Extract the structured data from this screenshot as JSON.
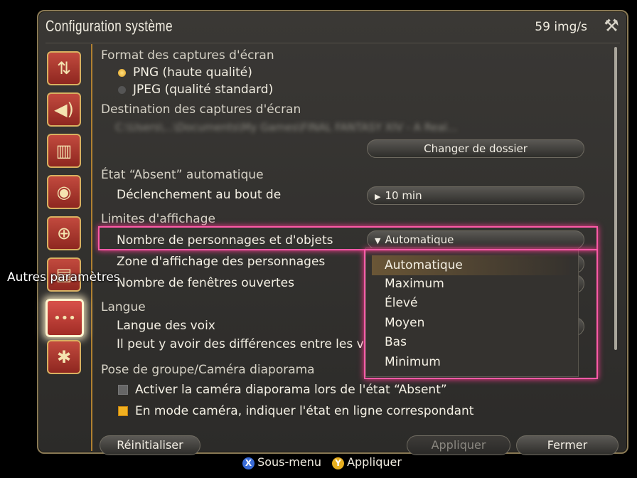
{
  "window": {
    "title": "Configuration système",
    "fps": "59 img/s",
    "tool_icon": "tools-icon"
  },
  "sidebar": {
    "tooltip": "Autres paramètres",
    "items": [
      {
        "icon": "display-icon",
        "glyph": "⇅"
      },
      {
        "icon": "sound-icon",
        "glyph": "🔊"
      },
      {
        "icon": "theater-icon",
        "glyph": "▥"
      },
      {
        "icon": "mouse-icon",
        "glyph": "🖱"
      },
      {
        "icon": "gamepad-icon",
        "glyph": "🎮"
      },
      {
        "icon": "document-icon",
        "glyph": "▤"
      },
      {
        "icon": "more-icon",
        "glyph": "•••"
      },
      {
        "icon": "character-icon",
        "glyph": "✱"
      }
    ]
  },
  "settings": {
    "screenshot_format": "Format des captures d'écran",
    "png": "PNG (haute qualité)",
    "jpeg": "JPEG (qualité standard)",
    "screenshot_dest": "Destination des captures d'écran",
    "dest_path": "C:\\Users\\...\\Documents\\My Games\\FINAL FANTASY XIV - A Real...",
    "change_folder": "Changer de dossier",
    "auto_afk": "État “Absent” automatique",
    "trigger_after": "Déclenchement au bout de",
    "trigger_value": "10 min",
    "display_limits": "Limites d'affichage",
    "num_chars": "Nombre de personnages et d'objets",
    "num_chars_value": "Automatique",
    "char_zone": "Zone d'affichage des personnages",
    "num_windows": "Nombre de fenêtres ouvertes",
    "language": "Langue",
    "voice_lang": "Langue des voix",
    "voice_note": "Il peut y avoir des différences entre les v",
    "group_pose": "Pose de groupe/Caméra diaporama",
    "slideshow_cam": "Activer la caméra diaporama lors de l'état “Absent”",
    "camera_mode": "En mode caméra, indiquer l'état en ligne correspondant"
  },
  "dropdown": {
    "options": [
      "Automatique",
      "Maximum",
      "Élevé",
      "Moyen",
      "Bas",
      "Minimum"
    ],
    "selected": "Automatique"
  },
  "buttons": {
    "reset": "Réinitialiser",
    "apply": "Appliquer",
    "close": "Fermer"
  },
  "hints": {
    "x_label": "Sous-menu",
    "y_label": "Appliquer"
  }
}
